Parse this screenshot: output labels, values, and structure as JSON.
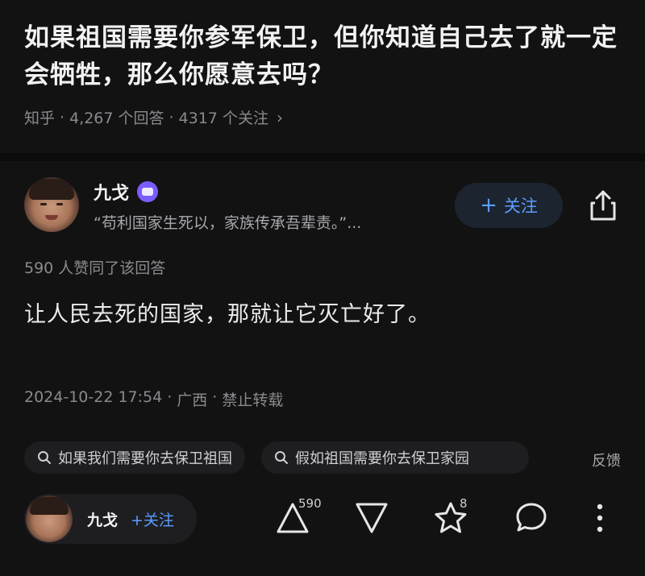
{
  "question": {
    "title": "如果祖国需要你参军保卫，但你知道自己去了就一定会牺牲，那么你愿意去吗？",
    "source": "知乎",
    "answer_count": "4,267 个回答",
    "follower_count": "4317 个关注"
  },
  "author": {
    "name": "九戈",
    "bio": "“苟利国家生死以，家族传承吾辈责。”...",
    "follow_label": "关注"
  },
  "answer": {
    "agree_text": "590 人赞同了该回答",
    "body": "让人民去死的国家，那就让它灭亡好了。",
    "datetime": "2024-10-22 17:54",
    "location": "广西",
    "repost_status": "禁止转载"
  },
  "related": {
    "chips": [
      "如果我们需要你去保卫祖国",
      "假如祖国需要你去保卫家园"
    ],
    "feedback": "反馈"
  },
  "bottom_bar": {
    "author_name": "九戈",
    "follow_label": "+关注",
    "upvote_count": "590",
    "favorite_count": "8"
  },
  "colors": {
    "background": "#121212",
    "accent": "#5b9dff",
    "badge": "#7c5cff"
  },
  "icons": [
    "chevron-right-icon",
    "verified-badge-icon",
    "share-icon",
    "search-icon",
    "upvote-icon",
    "downvote-icon",
    "star-icon",
    "comment-icon",
    "more-icon"
  ]
}
